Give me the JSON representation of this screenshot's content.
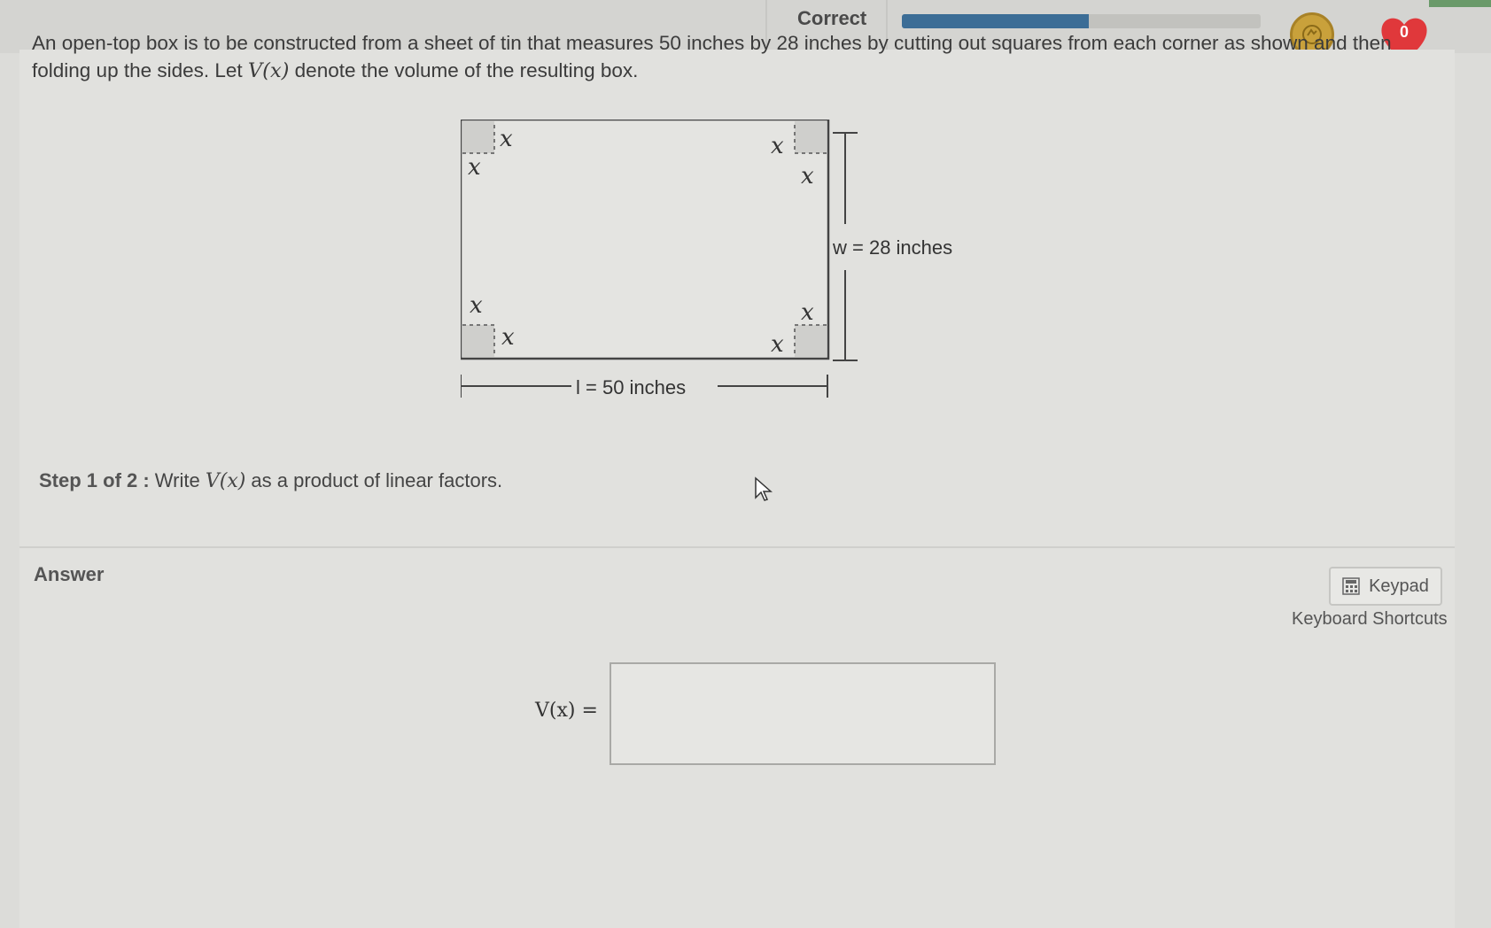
{
  "header": {
    "status_label": "Correct",
    "progress_percent": 52,
    "coin_icon": "coin-icon",
    "heart_count": "0",
    "colors": {
      "progress": "#3c6d96",
      "heart": "#e0383b",
      "coin": "#c9a13b"
    }
  },
  "problem": {
    "text_part1": "An open-top box is to be constructed from a sheet of tin that measures 50 inches by 28 inches by cutting out squares from each corner as shown and then folding up the sides. Let ",
    "vx": "V(x)",
    "text_part2": " denote the volume of the resulting box."
  },
  "figure": {
    "corner_label": "x",
    "width_label": "w = 28 inches",
    "length_label": "l = 50 inches"
  },
  "step": {
    "label": "Step 1 of 2 :",
    "text_part1": " Write ",
    "vx": "V(x)",
    "text_part2": " as a product of linear factors."
  },
  "answer": {
    "label": "Answer",
    "keypad_label": "Keypad",
    "shortcuts_label": "Keyboard Shortcuts",
    "input_label": "V(x) =",
    "input_value": ""
  }
}
